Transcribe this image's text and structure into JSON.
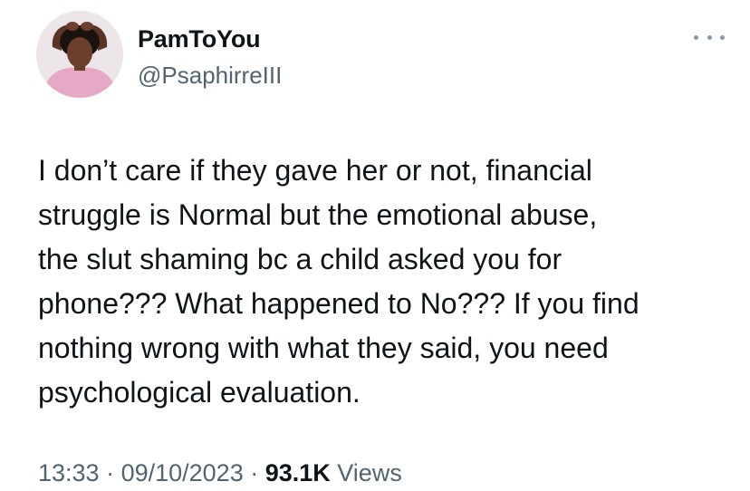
{
  "user": {
    "display_name": "PamToYou",
    "handle": "@PsaphirreIII",
    "avatar_icon": "profile-photo"
  },
  "menu": {
    "more_icon": "more-horizontal-icon"
  },
  "tweet": {
    "text": "I don’t care if they gave her or not, financial\nstruggle is Normal but the emotional abuse,\nthe slut shaming bc a child asked you for\nphone??? What happened to No??? If you find\nnothing wrong with what they said, you need\npsychological evaluation."
  },
  "meta": {
    "time": "13:33",
    "separator": " · ",
    "date": "09/10/2023",
    "views_count": "93.1K",
    "views_label": " Views"
  },
  "colors": {
    "text_primary": "#0f1419",
    "text_secondary": "#536471",
    "background": "#ffffff"
  }
}
